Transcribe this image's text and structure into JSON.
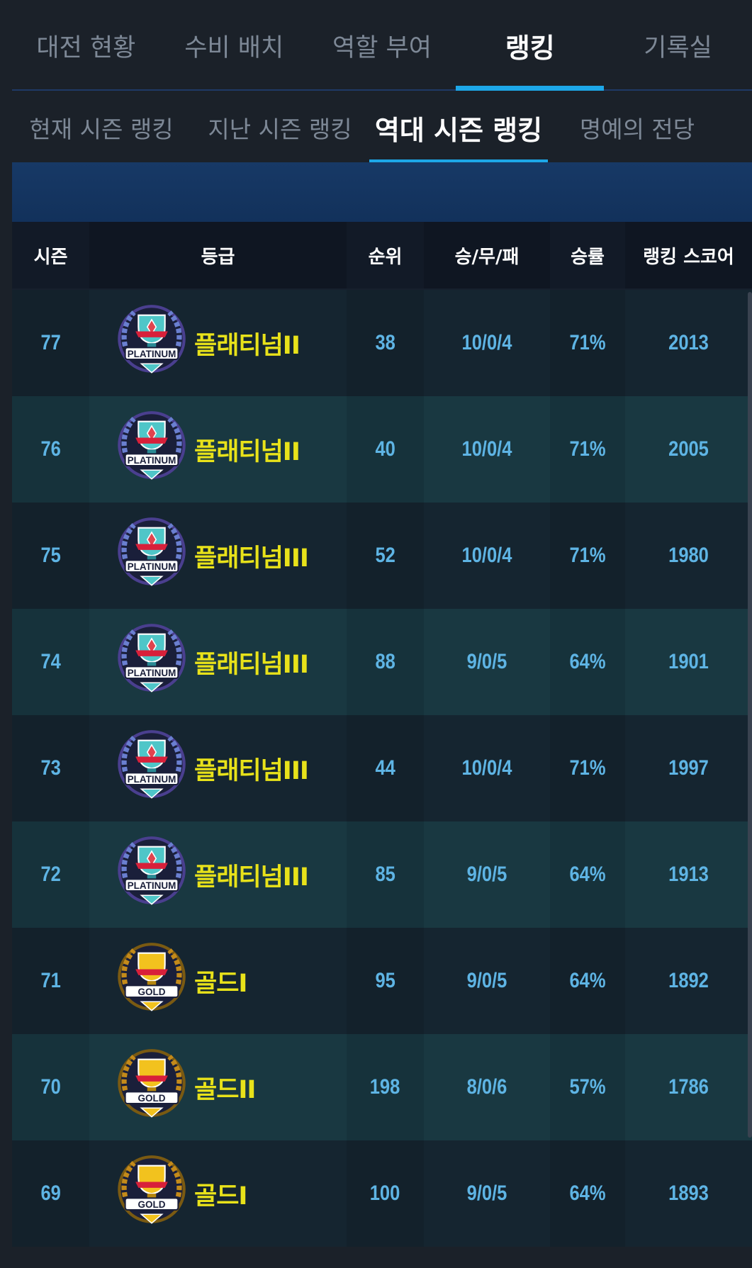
{
  "main_tabs": [
    {
      "label": "대전 현황"
    },
    {
      "label": "수비 배치"
    },
    {
      "label": "역할 부여"
    },
    {
      "label": "랭킹"
    },
    {
      "label": "기록실"
    }
  ],
  "main_tabs_active": "랭킹",
  "sub_tabs": [
    {
      "label": "현재 시즌 랭킹"
    },
    {
      "label": "지난 시즌 랭킹"
    },
    {
      "label": "역대 시즌 랭킹"
    },
    {
      "label": "명예의 전당"
    }
  ],
  "sub_tabs_active": "역대 시즌 랭킹",
  "table": {
    "headers": {
      "season": "시즌",
      "grade": "등급",
      "rank": "순위",
      "record": "승/무/패",
      "win_rate": "승률",
      "score": "랭킹 스코어"
    },
    "rows": [
      {
        "season": "77",
        "emblem": "PLATINUM",
        "tier": "platinum",
        "grade": "플래티넘II",
        "rank": "38",
        "record": "10/0/4",
        "win_rate": "71%",
        "score": "2013"
      },
      {
        "season": "76",
        "emblem": "PLATINUM",
        "tier": "platinum",
        "grade": "플래티넘II",
        "rank": "40",
        "record": "10/0/4",
        "win_rate": "71%",
        "score": "2005"
      },
      {
        "season": "75",
        "emblem": "PLATINUM",
        "tier": "platinum",
        "grade": "플래티넘III",
        "rank": "52",
        "record": "10/0/4",
        "win_rate": "71%",
        "score": "1980"
      },
      {
        "season": "74",
        "emblem": "PLATINUM",
        "tier": "platinum",
        "grade": "플래티넘III",
        "rank": "88",
        "record": "9/0/5",
        "win_rate": "64%",
        "score": "1901"
      },
      {
        "season": "73",
        "emblem": "PLATINUM",
        "tier": "platinum",
        "grade": "플래티넘III",
        "rank": "44",
        "record": "10/0/4",
        "win_rate": "71%",
        "score": "1997"
      },
      {
        "season": "72",
        "emblem": "PLATINUM",
        "tier": "platinum",
        "grade": "플래티넘III",
        "rank": "85",
        "record": "9/0/5",
        "win_rate": "64%",
        "score": "1913"
      },
      {
        "season": "71",
        "emblem": "GOLD",
        "tier": "gold",
        "grade": "골드I",
        "rank": "95",
        "record": "9/0/5",
        "win_rate": "64%",
        "score": "1892"
      },
      {
        "season": "70",
        "emblem": "GOLD",
        "tier": "gold",
        "grade": "골드II",
        "rank": "198",
        "record": "8/0/6",
        "win_rate": "57%",
        "score": "1786"
      },
      {
        "season": "69",
        "emblem": "GOLD",
        "tier": "gold",
        "grade": "골드I",
        "rank": "100",
        "record": "9/0/5",
        "win_rate": "64%",
        "score": "1893"
      }
    ]
  },
  "colors": {
    "background": "#1b2129",
    "accent": "#1da7e8",
    "value_text": "#5eb4e4",
    "grade_text": "#e8e21a",
    "row_odd": "#152530",
    "row_even": "#193841"
  },
  "icons": {
    "platinum": "platinum-trophy-emblem",
    "gold": "gold-trophy-emblem"
  }
}
